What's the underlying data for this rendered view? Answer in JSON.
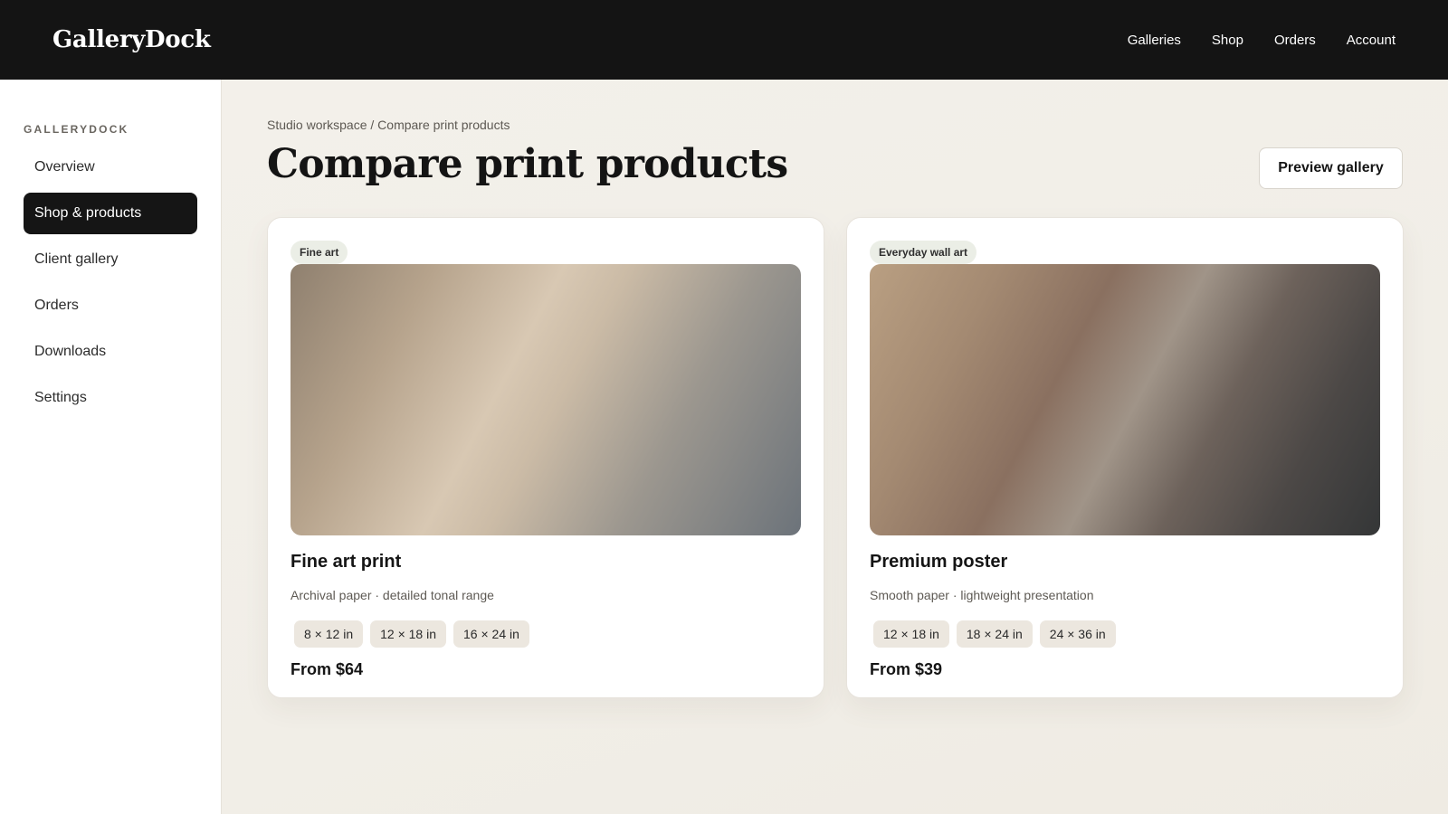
{
  "header": {
    "brand": "GalleryDock",
    "nav": [
      "Galleries",
      "Shop",
      "Orders",
      "Account"
    ]
  },
  "sidebar": {
    "heading": "GALLERYDOCK",
    "items": [
      {
        "label": "Overview",
        "active": false
      },
      {
        "label": "Shop & products",
        "active": true
      },
      {
        "label": "Client gallery",
        "active": false
      },
      {
        "label": "Orders",
        "active": false
      },
      {
        "label": "Downloads",
        "active": false
      },
      {
        "label": "Settings",
        "active": false
      }
    ]
  },
  "main": {
    "breadcrumb": "Studio workspace / Compare print products",
    "title": "Compare print products",
    "preview_button": "Preview gallery",
    "products": [
      {
        "tag": "Fine art",
        "name": "Fine art print",
        "description": "Archival paper · detailed tonal range",
        "sizes": [
          "8 × 12 in",
          "12 × 18 in",
          "16 × 24 in"
        ],
        "price": "From $64"
      },
      {
        "tag": "Everyday wall art",
        "name": "Premium poster",
        "description": "Smooth paper · lightweight presentation",
        "sizes": [
          "12 × 18 in",
          "18 × 24 in",
          "24 × 36 in"
        ],
        "price": "From $39"
      }
    ]
  },
  "colors": {
    "topbar": "#141414",
    "active_nav": "#151515",
    "background": "#f3f0ea",
    "tag_bg": "#ebeee6",
    "chip_bg": "#ece7df"
  }
}
